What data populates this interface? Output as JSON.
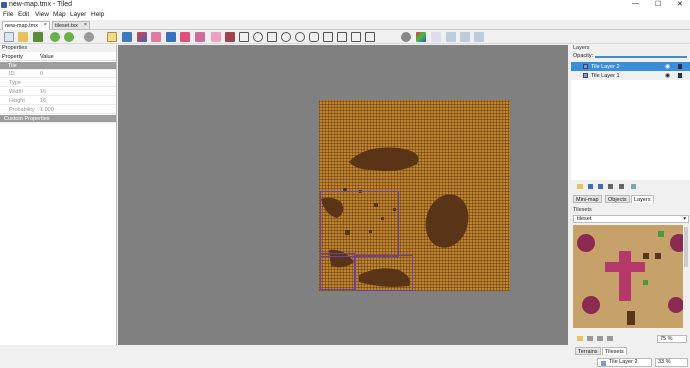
{
  "window": {
    "title": "new-map.tmx - Tiled",
    "minimize": "—",
    "maximize": "☐",
    "close": "✕"
  },
  "menu": [
    "File",
    "Edit",
    "View",
    "Map",
    "Layer",
    "Help"
  ],
  "doc_tabs": [
    {
      "label": "new-map.tmx",
      "close": "×"
    },
    {
      "label": "tileset.tsx",
      "close": "×"
    }
  ],
  "toolbar_icons": [
    "new-icon",
    "open-icon",
    "save-icon",
    "undo-icon",
    "redo-icon",
    "command-icon",
    "stamp-brush-icon",
    "terrain-brush-icon",
    "bucket-fill-icon",
    "eraser-icon",
    "rect-select-icon",
    "magic-wand-icon",
    "select-same-tile-icon",
    "select-objects-icon",
    "edit-polygons-icon",
    "insert-rectangle-icon",
    "insert-ellipse-icon",
    "insert-polygon-icon",
    "insert-polyline-icon",
    "insert-tile-icon",
    "insert-text-icon",
    "random-mode-icon",
    "terrain-icon",
    "flip-horizontal-icon",
    "flip-vertical-icon",
    "rotate-left-icon",
    "rotate-right-icon"
  ],
  "properties": {
    "title": "Properties",
    "header_key": "Property",
    "header_value": "Value",
    "group": "Tile",
    "rows": [
      {
        "k": "ID",
        "v": "0"
      },
      {
        "k": "Type",
        "v": ""
      },
      {
        "k": "Width",
        "v": "16"
      },
      {
        "k": "Height",
        "v": "16"
      },
      {
        "k": "Probability",
        "v": "1.000"
      }
    ],
    "custom": "Custom Properties"
  },
  "layers_panel": {
    "title": "Layers",
    "opacity_label": "Opacity:",
    "layers": [
      {
        "name": "Tile Layer 2",
        "selected": true
      },
      {
        "name": "Tile Layer 1",
        "selected": false
      }
    ],
    "bottom_tabs": [
      "Mini-map",
      "Objects",
      "Layers"
    ],
    "active_tab": "Layers"
  },
  "tilesets_panel": {
    "title": "Tilesets",
    "selected_tileset": "tileset",
    "zoom": "75 %",
    "bottom_tabs": [
      "Terrains",
      "Tilesets"
    ],
    "active_tab": "Tilesets"
  },
  "status": {
    "layer": "Tile Layer 2",
    "zoom": "33 %"
  },
  "colors": {
    "ground": "#c0842c",
    "dark_patch": "#5a3416",
    "selection": "#6a3fa8",
    "accent": "#3b8fd9"
  }
}
